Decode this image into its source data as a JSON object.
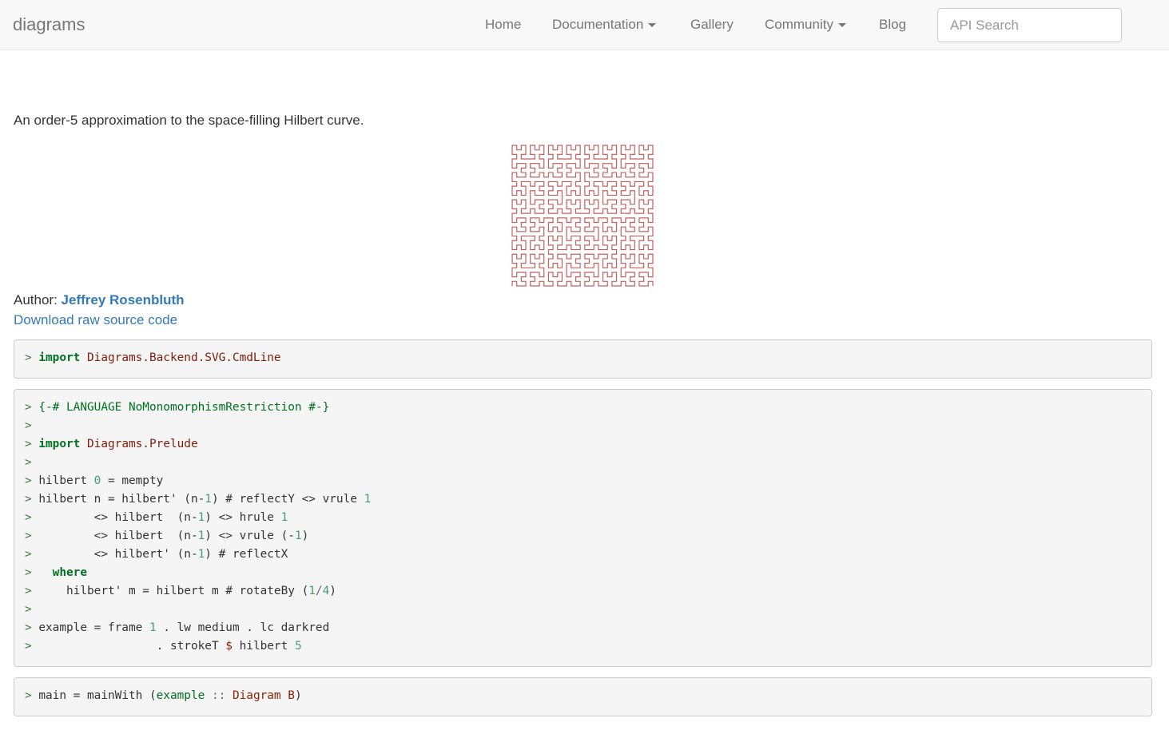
{
  "navbar": {
    "brand": "diagrams",
    "items": [
      {
        "label": "Home"
      },
      {
        "label": "Documentation"
      },
      {
        "label": "Gallery"
      },
      {
        "label": "Community"
      },
      {
        "label": "Blog"
      }
    ],
    "search_placeholder": "API Search"
  },
  "content": {
    "description": "An order-5 approximation to the space-filling Hilbert curve.",
    "curve_order": 5,
    "curve_color": "#c06060",
    "author_label": "Author: ",
    "author_name": "Jeffrey Rosenbluth",
    "download_label": "Download raw source code"
  },
  "code": {
    "block1": {
      "prompt": ">",
      "kw": "import",
      "module": "Diagrams.Backend.SVG.CmdLine"
    },
    "block2": {
      "prompt": ">",
      "pragma": "{-# LANGUAGE NoMonomorphismRestriction #-}",
      "import_kw": "import",
      "import_module": "Diagrams.Prelude",
      "l5_a": "hilbert ",
      "l5_n": "0",
      "l5_b": " = mempty",
      "l6_a": "hilbert n = hilbert' (n-",
      "l6_n1": "1",
      "l6_b": ") # reflectY <> vrule ",
      "l6_n2": "1",
      "l7_a": "        <> hilbert  (n-",
      "l7_n1": "1",
      "l7_b": ") <> hrule ",
      "l7_n2": "1",
      "l8_a": "        <> hilbert  (n-",
      "l8_n1": "1",
      "l8_b": ") <> vrule (-",
      "l8_n2": "1",
      "l8_c": ")",
      "l9_a": "        <> hilbert' (n-",
      "l9_n1": "1",
      "l9_b": ") # reflectX",
      "l10_indent": "  ",
      "l10_kw": "where",
      "l11_a": "    hilbert' m = hilbert m # rotateBy (",
      "l11_n1": "1",
      "l11_op": "/",
      "l11_n2": "4",
      "l11_b": ")",
      "l13_a": "example = frame ",
      "l13_n": "1",
      "l13_b": " . lw medium . lc darkred",
      "l14_a": "                 . strokeT ",
      "l14_op": "$",
      "l14_b": " hilbert ",
      "l14_n": "5"
    },
    "block3": {
      "prompt": ">",
      "a": "main = mainWith (",
      "b": "example",
      "c": " :: ",
      "d": "Diagram B",
      "e": ")"
    }
  }
}
